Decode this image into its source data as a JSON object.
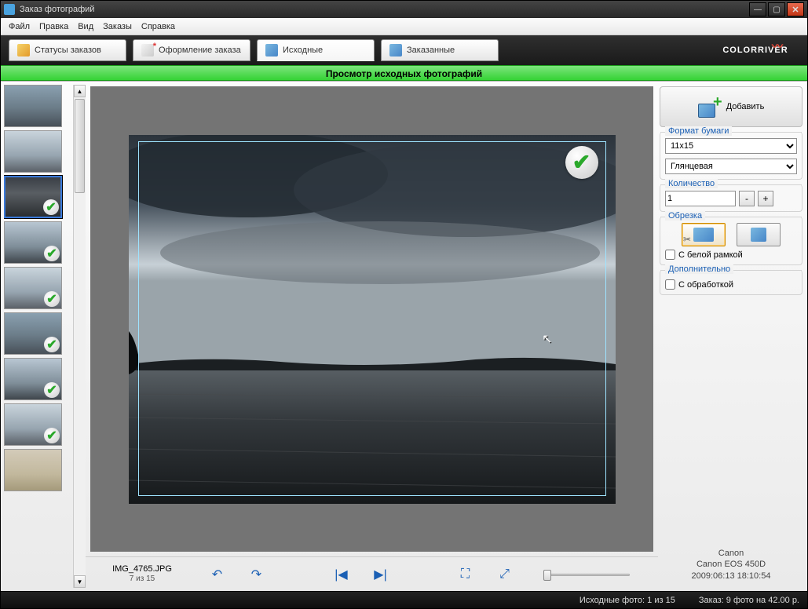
{
  "window": {
    "title": "Заказ фотографий"
  },
  "menu": {
    "file": "Файл",
    "edit": "Правка",
    "view": "Вид",
    "orders": "Заказы",
    "help": "Справка"
  },
  "tabs": {
    "status": "Статусы заказов",
    "checkout": "Оформление заказа",
    "source": "Исходные",
    "ordered": "Заказанные"
  },
  "brand": "COLORRIVER",
  "banner": "Просмотр исходных фотографий",
  "file": {
    "name": "IMG_4765.JPG",
    "index": "7 из 15"
  },
  "panel": {
    "add": "Добавить",
    "paper_group": "Формат бумаги",
    "paper_size": "11x15",
    "paper_finish": "Глянцевая",
    "qty_group": "Количество",
    "qty": "1",
    "crop_group": "Обрезка",
    "white_border": "С белой рамкой",
    "extra_group": "Дополнительно",
    "processing": "С обработкой"
  },
  "camera": {
    "make": "Canon",
    "model": "Canon EOS 450D",
    "datetime": "2009:06:13 18:10:54"
  },
  "status": {
    "source": "Исходные фото:  1 из 15",
    "order": "Заказ: 9 фото на 42.00 р."
  },
  "thumbs": [
    {
      "cls": "sky-a",
      "checked": false,
      "selected": false
    },
    {
      "cls": "sky-b",
      "checked": false,
      "selected": false
    },
    {
      "cls": "sky-c",
      "checked": true,
      "selected": true
    },
    {
      "cls": "sky-d",
      "checked": true,
      "selected": false
    },
    {
      "cls": "sky-b",
      "checked": true,
      "selected": false
    },
    {
      "cls": "sky-a",
      "checked": true,
      "selected": false
    },
    {
      "cls": "sky-d",
      "checked": true,
      "selected": false
    },
    {
      "cls": "sky-b",
      "checked": true,
      "selected": false
    },
    {
      "cls": "sky-e",
      "checked": false,
      "selected": false
    }
  ]
}
